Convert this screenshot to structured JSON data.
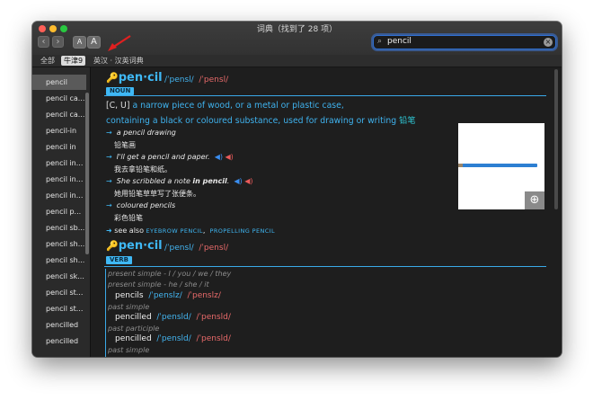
{
  "window": {
    "title": "词典（找到了 28 项）"
  },
  "toolbar": {
    "back": "‹",
    "forward": "›",
    "font_small": "A",
    "font_large": "A"
  },
  "search": {
    "value": "pencil",
    "icon": "search-icon"
  },
  "filters": [
    "全部",
    "牛津9",
    "英汉 · 汉英词典"
  ],
  "sidebar": {
    "items": [
      "pencil",
      "pencil ca...",
      "pencil ca...",
      "pencil-in",
      "pencil in",
      "pencil in...",
      "pencil in...",
      "pencil in...",
      "pencil p...",
      "pencil sb...",
      "pencil sh...",
      "pencil sh...",
      "pencil sk...",
      "pencil st...",
      "pencil st...",
      "pencilled",
      "pencilled"
    ]
  },
  "entry1": {
    "headword": "pen·cil",
    "key_icon": "🔑",
    "pron_uk": "/ˈpensl/",
    "pron_us": "/ˈpensl/",
    "pos": "NOUN",
    "grammar": "[C, U]",
    "def_line1": "a narrow piece of wood,  or a metal or plastic case,",
    "def_line2": "containing a black or coloured substance,  used for drawing or writing",
    "def_zh": "铅笔",
    "examples": [
      {
        "en": "a pencil drawing",
        "zh": "铅笔画"
      },
      {
        "en": "I'll get a pencil and paper.",
        "zh": "我去拿铅笔和纸。"
      },
      {
        "en_pre": "She scribbled a note ",
        "en_bold": "in pencil",
        "en_post": ".",
        "zh": "她用铅笔草草写了张便条。"
      },
      {
        "en": "coloured pencils",
        "zh": "彩色铅笔"
      }
    ],
    "see_also_label": "see also",
    "see_also_1": "EYEBROW PENCIL",
    "see_also_2": "PROPELLING PENCIL"
  },
  "entry2": {
    "headword": "pen·cil",
    "pron_uk": "/ˈpensl/",
    "pron_us": "/ˈpensl/",
    "pos": "VERB",
    "forms": [
      {
        "label": "present simple - I / you / we / they",
        "word": "pencils",
        "uk": "/ˈpenslz/",
        "us": "/ˈpenslz/"
      },
      {
        "label": "present simple - he / she / it",
        "word": "",
        "uk": "",
        "us": ""
      },
      {
        "label": "past simple",
        "word": "pencilled",
        "uk": "/ˈpensld/",
        "us": "/ˈpensld/"
      },
      {
        "label": "past participle",
        "word": "pencilled",
        "uk": "/ˈpensld/",
        "us": "/ˈpensld/"
      },
      {
        "label": "past simple",
        "word": "",
        "uk": "",
        "us": ""
      }
    ]
  },
  "colors": {
    "accent": "#3fb8f5",
    "window_bg": "#1e1e1e",
    "annotation": "#e02020"
  }
}
